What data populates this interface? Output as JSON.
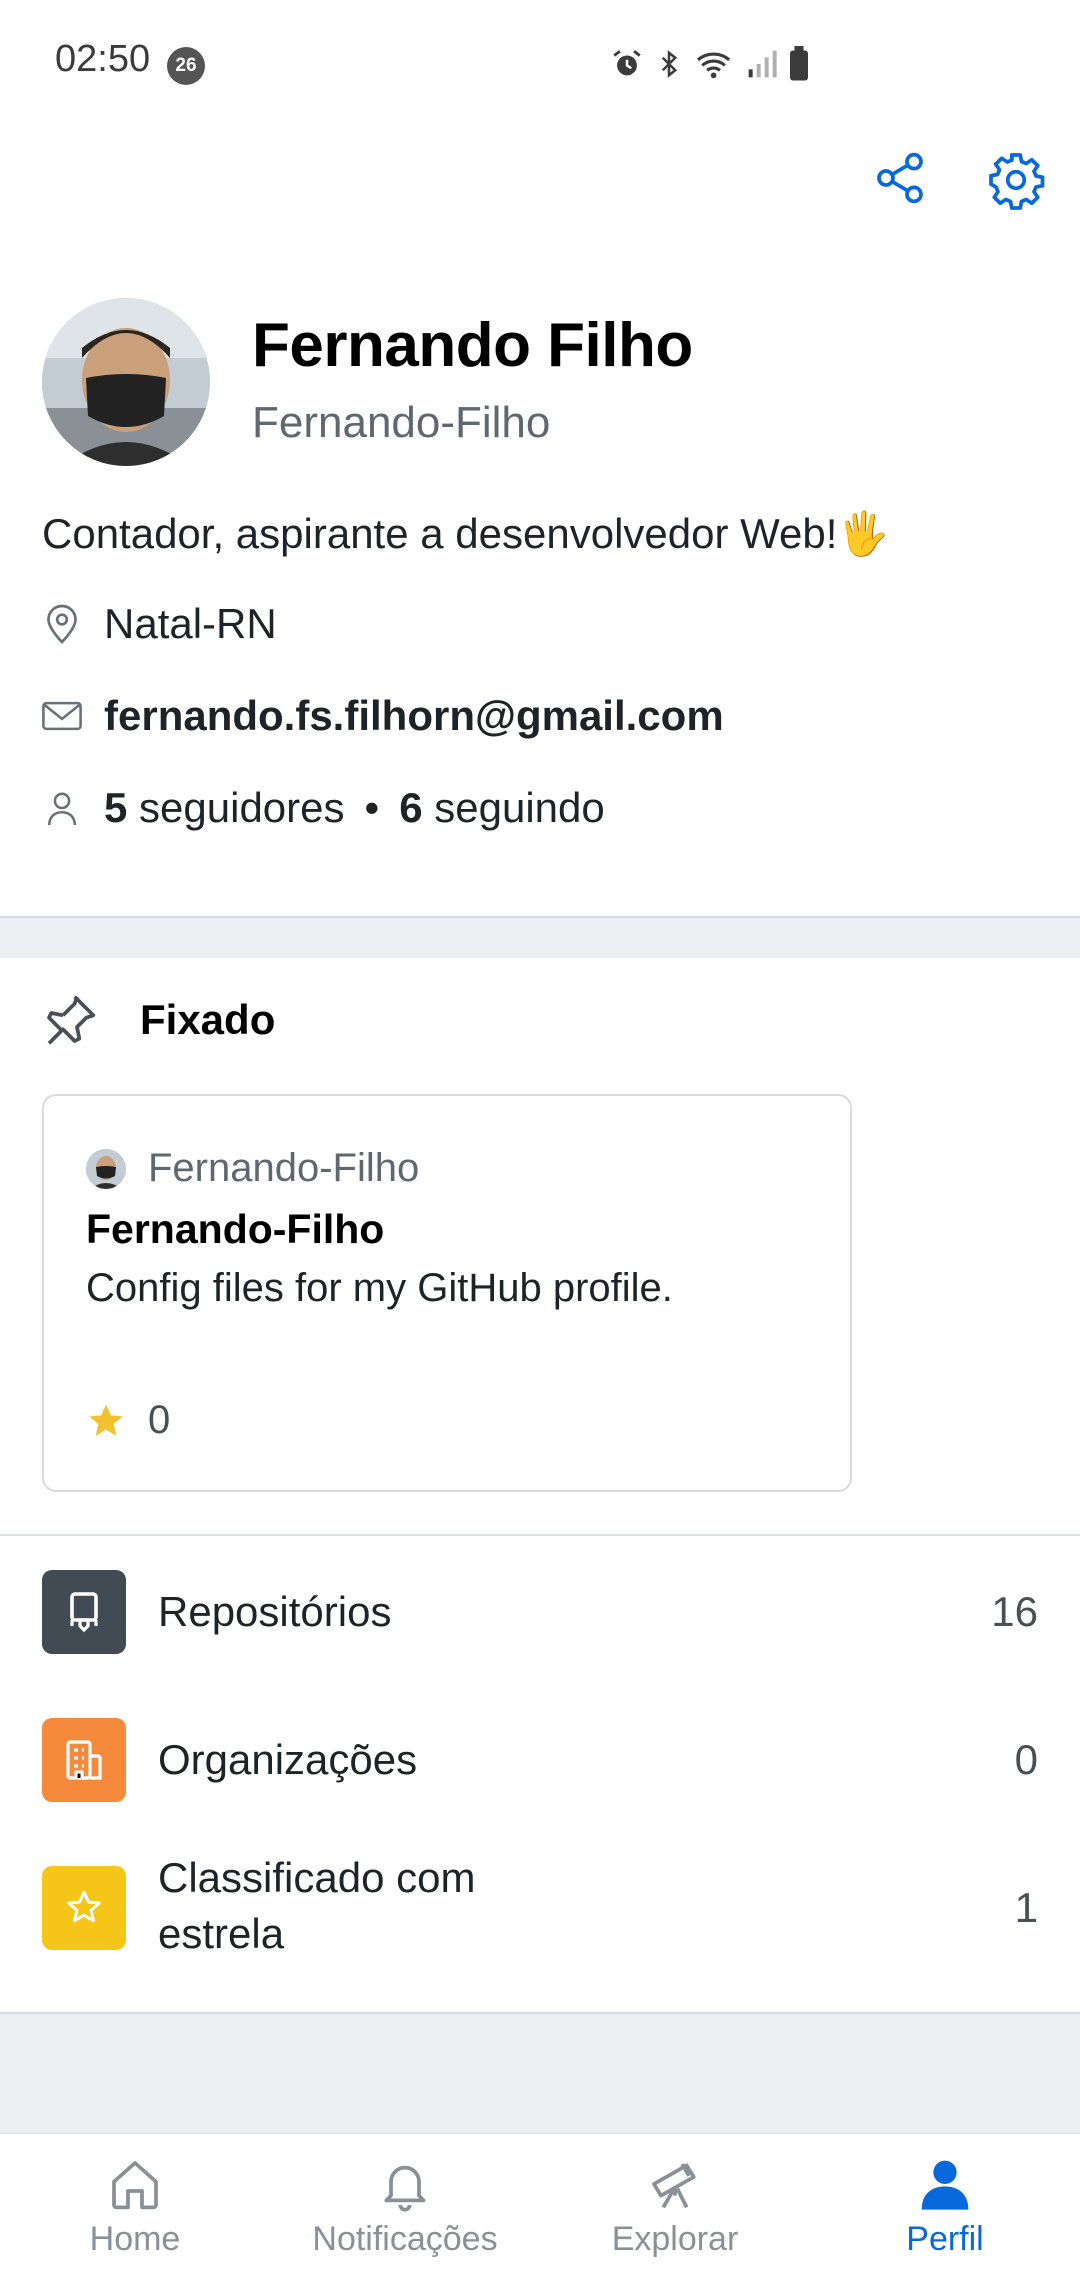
{
  "status_bar": {
    "time": "02:50",
    "notification_count": "26",
    "icons": [
      "alarm-icon",
      "bluetooth-icon",
      "wifi-icon",
      "signal-icon",
      "battery-icon"
    ]
  },
  "header": {
    "actions": [
      "share-icon",
      "settings-gear-icon"
    ]
  },
  "profile": {
    "name": "Fernando Filho",
    "login": "Fernando-Filho",
    "bio": "Contador, aspirante a desenvolvedor Web!🖐",
    "location": "Natal-RN",
    "email": "fernando.fs.filhorn@gmail.com",
    "followers_count": "5",
    "followers_label": "seguidores",
    "separator": "•",
    "following_count": "6",
    "following_label": "seguindo"
  },
  "pinned": {
    "title": "Fixado",
    "card": {
      "owner": "Fernando-Filho",
      "repo": "Fernando-Filho",
      "description": "Config files for my GitHub profile.",
      "stars": "0"
    }
  },
  "menu": {
    "items": [
      {
        "label": "Repositórios",
        "count": "16",
        "icon": "repo-icon",
        "color": "#424a53"
      },
      {
        "label": "Organizações",
        "count": "0",
        "icon": "organization-icon",
        "color": "#f58a3c"
      },
      {
        "label": "Classificado com estrela",
        "count": "1",
        "icon": "star-icon",
        "color": "#f5c518"
      }
    ]
  },
  "bottom_nav": {
    "items": [
      {
        "label": "Home",
        "icon": "home-icon"
      },
      {
        "label": "Notificações",
        "icon": "bell-icon"
      },
      {
        "label": "Explorar",
        "icon": "telescope-icon"
      },
      {
        "label": "Perfil",
        "icon": "person-icon",
        "active": true
      }
    ],
    "active_color": "#0969da"
  }
}
